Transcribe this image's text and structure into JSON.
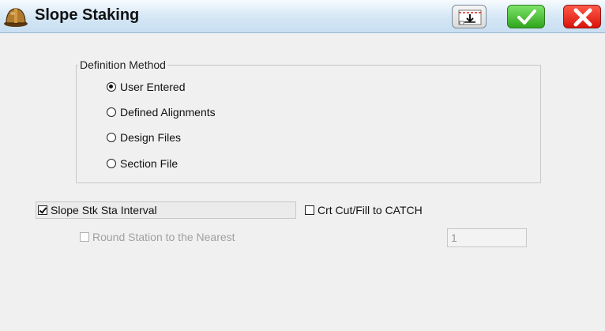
{
  "window": {
    "title": "Slope Staking",
    "icons": {
      "app": "hardhat-icon",
      "tool": "keypad-download-icon",
      "ok": "checkmark-icon",
      "close": "close-x-icon"
    },
    "colors": {
      "ok": "#3cb72a",
      "close": "#e5170d",
      "titlebar": "#d4e6f5"
    }
  },
  "definition_method": {
    "legend": "Definition Method",
    "options": [
      {
        "label": "User Entered",
        "checked": true
      },
      {
        "label": "Defined Alignments",
        "checked": false
      },
      {
        "label": "Design Files",
        "checked": false
      },
      {
        "label": "Section File",
        "checked": false
      }
    ]
  },
  "options": {
    "slope_stk_sta_interval": {
      "label": "Slope Stk Sta Interval",
      "checked": true
    },
    "crt_cut_fill": {
      "label": "Crt Cut/Fill to CATCH",
      "checked": false
    },
    "round_station": {
      "label": "Round Station to the Nearest",
      "checked": false,
      "enabled": false,
      "value": "1"
    }
  }
}
